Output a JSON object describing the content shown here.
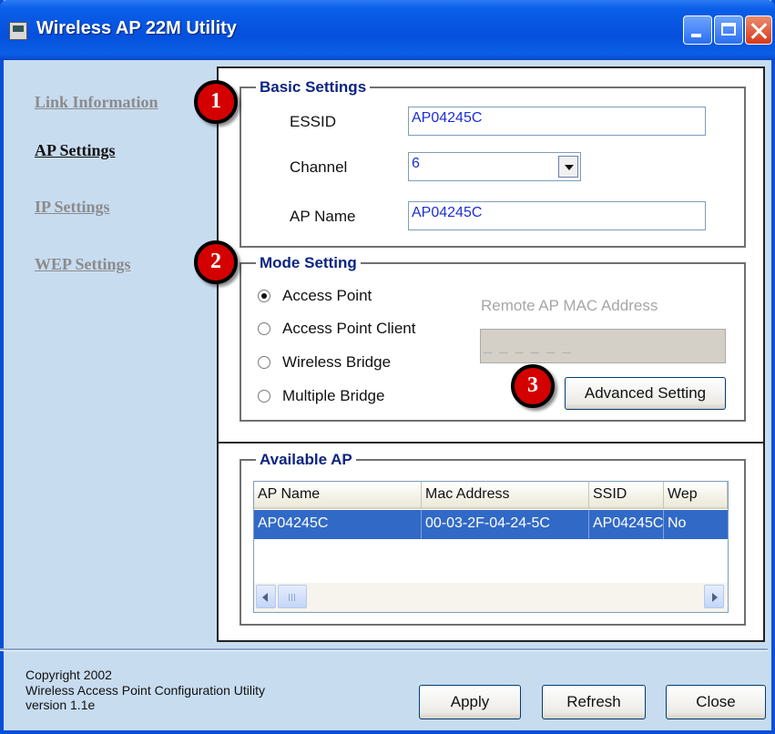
{
  "window": {
    "title": "Wireless AP 22M Utility"
  },
  "nav": [
    {
      "label": "Link Information",
      "active": false
    },
    {
      "label": "AP Settings",
      "active": true
    },
    {
      "label": "IP Settings",
      "active": false
    },
    {
      "label": "WEP Settings",
      "active": false
    }
  ],
  "basic_settings": {
    "title": "Basic Settings",
    "essid_label": "ESSID",
    "essid_value": "AP04245C",
    "channel_label": "Channel",
    "channel_value": "6",
    "ap_name_label": "AP Name",
    "ap_name_value": "AP04245C"
  },
  "mode_setting": {
    "title": "Mode Setting",
    "options": [
      {
        "label": "Access Point",
        "selected": true
      },
      {
        "label": "Access Point Client",
        "selected": false
      },
      {
        "label": "Wireless Bridge",
        "selected": false
      },
      {
        "label": "Multiple Bridge",
        "selected": false
      }
    ],
    "remote_mac_label": "Remote AP MAC Address",
    "remote_mac_mask": "_ _ _ _ _ _",
    "advanced_button": "Advanced Setting"
  },
  "available_ap": {
    "title": "Available AP",
    "columns": [
      "AP Name",
      "Mac Address",
      "SSID",
      "Wep"
    ],
    "rows": [
      [
        "AP04245C",
        "00-03-2F-04-24-5C",
        "AP04245C",
        "No"
      ]
    ]
  },
  "badges": [
    "1",
    "2",
    "3"
  ],
  "footer": {
    "copyright": "Copyright 2002",
    "product": "Wireless Access Point Configuration Utility",
    "version": "version 1.1e",
    "apply": "Apply",
    "refresh": "Refresh",
    "close": "Close"
  },
  "colors": {
    "titlebar": "#0550dc",
    "window_bg": "#c8dcf0",
    "legend_text": "#0c2482",
    "field_text": "#1b2ed6",
    "selection": "#3169c6",
    "badge": "#d40000"
  }
}
